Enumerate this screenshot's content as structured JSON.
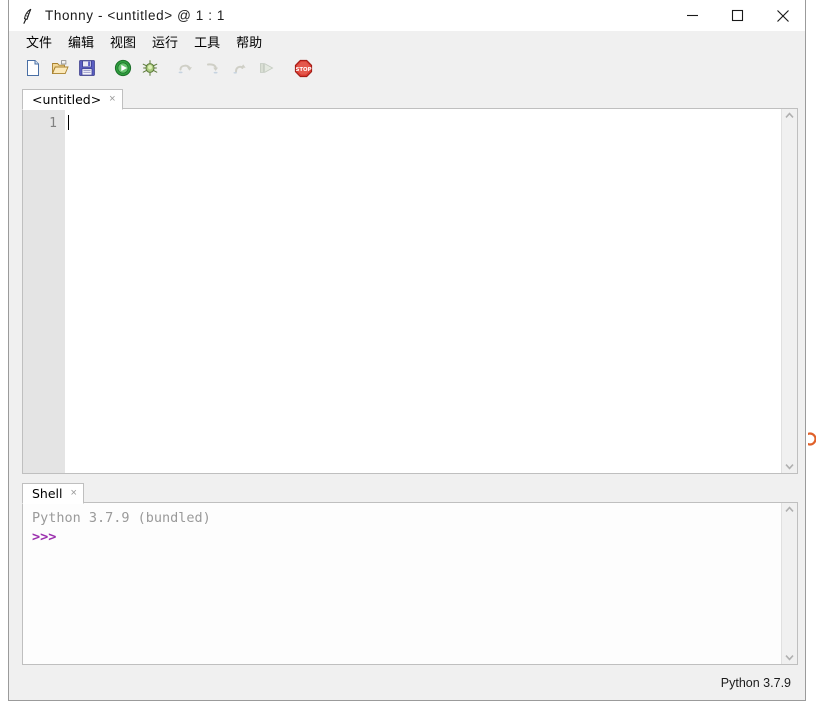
{
  "window": {
    "title": "Thonny  -  <untitled>  @  1 : 1",
    "app_icon": "feather-quill-icon",
    "controls": {
      "minimize": "minimize-icon",
      "maximize": "maximize-icon",
      "close": "close-icon"
    }
  },
  "menubar": {
    "items": [
      {
        "label": "文件",
        "name": "menu-file"
      },
      {
        "label": "编辑",
        "name": "menu-edit"
      },
      {
        "label": "视图",
        "name": "menu-view"
      },
      {
        "label": "运行",
        "name": "menu-run"
      },
      {
        "label": "工具",
        "name": "menu-tools"
      },
      {
        "label": "帮助",
        "name": "menu-help"
      }
    ]
  },
  "toolbar": {
    "buttons": [
      {
        "name": "new-file-icon",
        "title": "New",
        "enabled": true
      },
      {
        "name": "open-file-icon",
        "title": "Open",
        "enabled": true
      },
      {
        "name": "save-file-icon",
        "title": "Save",
        "enabled": true
      },
      {
        "name": "run-icon",
        "title": "Run",
        "enabled": true
      },
      {
        "name": "debug-bug-icon",
        "title": "Debug",
        "enabled": true
      },
      {
        "name": "step-over-icon",
        "title": "Step over",
        "enabled": false
      },
      {
        "name": "step-into-icon",
        "title": "Step into",
        "enabled": false
      },
      {
        "name": "step-out-icon",
        "title": "Step out",
        "enabled": false
      },
      {
        "name": "resume-icon",
        "title": "Resume",
        "enabled": false
      },
      {
        "name": "stop-icon",
        "title": "Stop",
        "enabled": true
      }
    ]
  },
  "editor": {
    "tabs": [
      {
        "label": "<untitled>",
        "close": "×",
        "active": true
      }
    ],
    "line_numbers": [
      "1"
    ],
    "content": "",
    "scrollbar": {
      "up": "chevron-up-icon",
      "down": "chevron-down-icon"
    }
  },
  "shell": {
    "tabs": [
      {
        "label": "Shell",
        "close": "×",
        "active": true
      }
    ],
    "banner": "Python 3.7.9 (bundled)",
    "prompt": ">>>",
    "scrollbar": {
      "up": "chevron-up-icon",
      "down": "chevron-down-icon"
    }
  },
  "statusbar": {
    "interpreter": "Python 3.7.9"
  },
  "colors": {
    "window_bg": "#f0f0f0",
    "editor_bg": "#ffffff",
    "gutter_bg": "#e4e4e4",
    "gutter_fg": "#808080",
    "shell_banner": "#9a9a9a",
    "shell_prompt": "#9b2fae",
    "border": "#bfbfbf",
    "run_green": "#2e9e3e",
    "stop_red": "#cf2027"
  }
}
